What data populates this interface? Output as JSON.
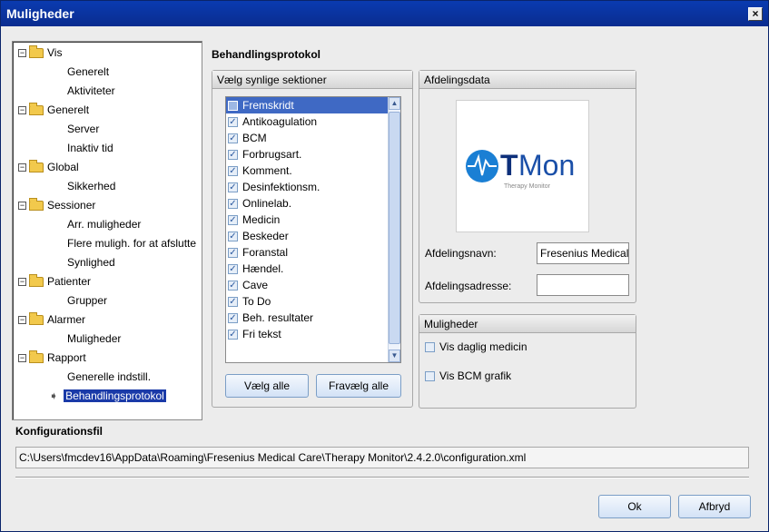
{
  "window": {
    "title": "Muligheder",
    "close_label": "×"
  },
  "tree": {
    "items": [
      {
        "label": "Vis",
        "level": 0,
        "toggle": "−"
      },
      {
        "label": "Generelt",
        "level": 1
      },
      {
        "label": "Aktiviteter",
        "level": 1
      },
      {
        "label": "Generelt",
        "level": 0,
        "toggle": "−"
      },
      {
        "label": "Server",
        "level": 1
      },
      {
        "label": "Inaktiv tid",
        "level": 1
      },
      {
        "label": "Global",
        "level": 0,
        "toggle": "−"
      },
      {
        "label": "Sikkerhed",
        "level": 1
      },
      {
        "label": "Sessioner",
        "level": 0,
        "toggle": "−"
      },
      {
        "label": "Arr. muligheder",
        "level": 1
      },
      {
        "label": "Flere muligh. for at afslutte",
        "level": 1
      },
      {
        "label": "Synlighed",
        "level": 1
      },
      {
        "label": "Patienter",
        "level": 0,
        "toggle": "−"
      },
      {
        "label": "Grupper",
        "level": 1
      },
      {
        "label": "Alarmer",
        "level": 0,
        "toggle": "−"
      },
      {
        "label": "Muligheder",
        "level": 1
      },
      {
        "label": "Rapport",
        "level": 0,
        "toggle": "−"
      },
      {
        "label": "Generelle indstill.",
        "level": 1
      },
      {
        "label": "Behandlingsprotokol",
        "level": 1,
        "selected": true
      }
    ]
  },
  "main": {
    "heading": "Behandlingsprotokol",
    "sections_group": {
      "title": "Vælg synlige sektioner",
      "items": [
        {
          "label": "Fremskridt",
          "checked": false,
          "active": true
        },
        {
          "label": "Antikoagulation",
          "checked": true
        },
        {
          "label": "BCM",
          "checked": true
        },
        {
          "label": "Forbrugsart.",
          "checked": true
        },
        {
          "label": "Komment.",
          "checked": true
        },
        {
          "label": "Desinfektionsm.",
          "checked": true
        },
        {
          "label": "Onlinelab.",
          "checked": true
        },
        {
          "label": "Medicin",
          "checked": true
        },
        {
          "label": "Beskeder",
          "checked": true
        },
        {
          "label": "Foranstal",
          "checked": true
        },
        {
          "label": "Hændel.",
          "checked": true
        },
        {
          "label": "Cave",
          "checked": true
        },
        {
          "label": "To Do",
          "checked": true
        },
        {
          "label": "Beh. resultater",
          "checked": true
        },
        {
          "label": "Fri tekst",
          "checked": true
        }
      ],
      "select_all": "Vælg alle",
      "deselect_all": "Fravælg alle"
    },
    "department": {
      "title": "Afdelingsdata",
      "logo_text": "TMon",
      "logo_subtitle": "Therapy Monitor",
      "name_label": "Afdelingsnavn:",
      "name_value": "Fresenius Medical C",
      "address_label": "Afdelingsadresse:",
      "address_value": ""
    },
    "options": {
      "title": "Muligheder",
      "show_daily_medicine": "Vis daglig medicin",
      "show_bcm_graph": "Vis BCM grafik"
    }
  },
  "config": {
    "label": "Konfigurationsfil",
    "path": "C:\\Users\\fmcdev16\\AppData\\Roaming\\Fresenius Medical Care\\Therapy Monitor\\2.4.2.0\\configuration.xml"
  },
  "footer": {
    "ok": "Ok",
    "cancel": "Afbryd"
  },
  "colors": {
    "titlebar": "#0a2c8f",
    "selection": "#1a3aa8",
    "list_active": "#3f69c4",
    "logo_blue": "#1a4fa8"
  }
}
